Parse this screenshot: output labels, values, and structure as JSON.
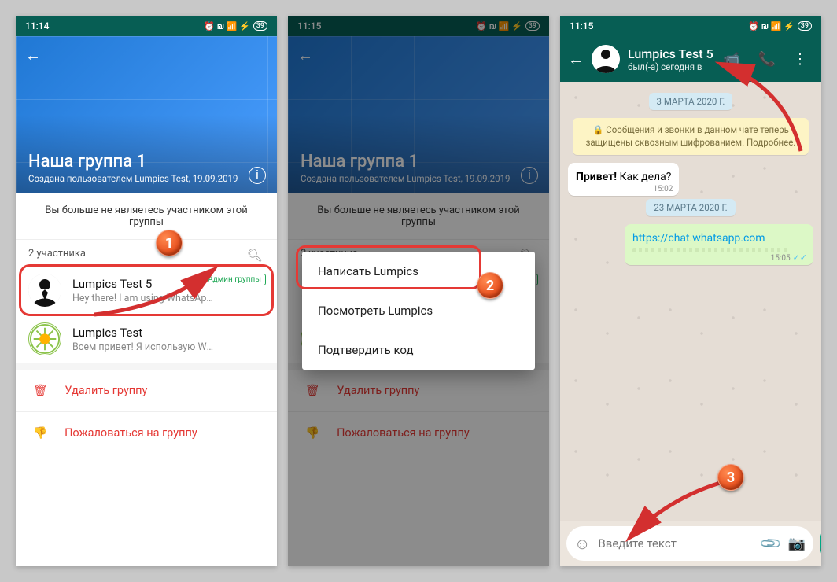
{
  "status": {
    "t1": "11:14",
    "t2": "11:15",
    "t3": "11:15",
    "battery": "39",
    "icons": "⏰ 📶 📡 ⚡"
  },
  "group": {
    "title": "Наша группа 1",
    "created": "Создана пользователем Lumpics Test, 19.09.2019",
    "notice": "Вы больше не являетесь участником этой группы",
    "participants_label": "2 участника",
    "admin_badge": "Админ группы"
  },
  "participants": [
    {
      "name": "Lumpics Test 5",
      "status": "Hey there! I am using WhatsApp."
    },
    {
      "name": "Lumpics Test",
      "status": "Всем привет! Я использую WhatsApp."
    }
  ],
  "actions": {
    "delete": "Удалить группу",
    "report": "Пожаловаться на группу"
  },
  "menu": {
    "write": "Написать Lumpics",
    "view": "Посмотреть Lumpics",
    "verify": "Подтвердить код"
  },
  "chat": {
    "title": "Lumpics Test 5",
    "subtitle": "был(-а) сегодня в ",
    "date1": "3 МАРТА 2020 Г.",
    "security": "🔒 Сообщения и звонки в данном чате теперь защищены сквозным шифрованием. Подробнее.",
    "msg1": "Привет!",
    "msg1b": " Как дела?",
    "msg1_time": "15:02",
    "date2": "23 МАРТА 2020 Г.",
    "msg2": "https://chat.whatsapp.com",
    "msg2_time": "15:05",
    "placeholder": "Введите текст"
  },
  "badges": {
    "b1": "1",
    "b2": "2",
    "b3": "3"
  }
}
